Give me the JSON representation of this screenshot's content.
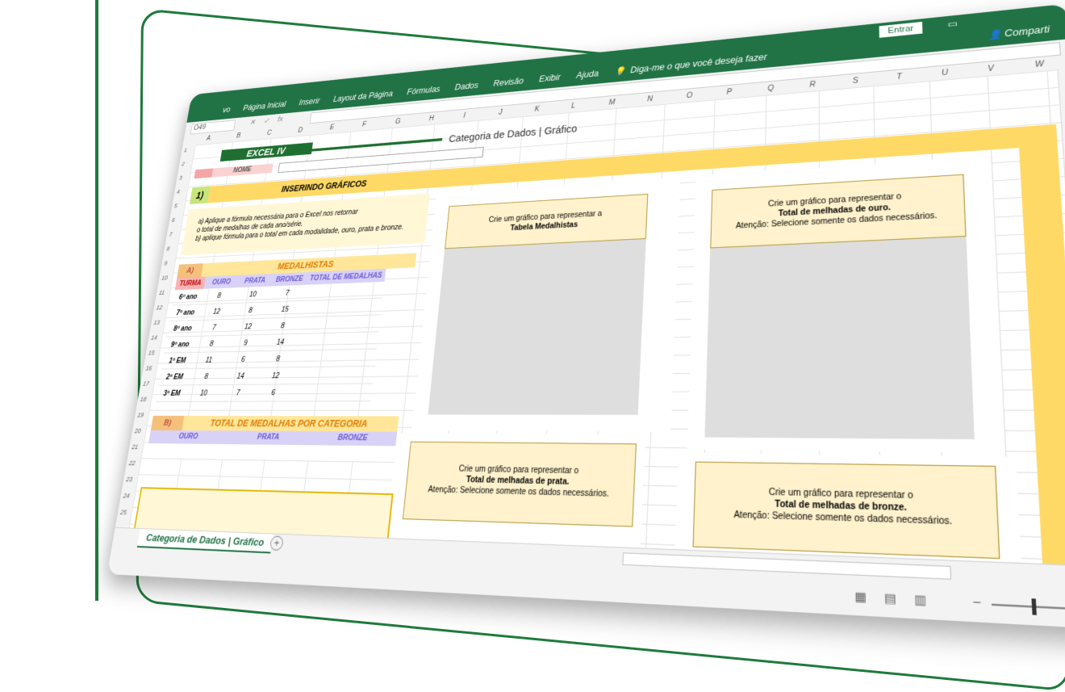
{
  "ribbon": {
    "tabs": [
      "vo",
      "Página Inicial",
      "Inserir",
      "Layout da Página",
      "Fórmulas",
      "Dados",
      "Revisão",
      "Exibir",
      "Ajuda"
    ],
    "tell_me": "Diga-me o que você deseja fazer",
    "entrar": "Entrar",
    "share": "Comparti"
  },
  "formula_bar": {
    "name_box": "O49",
    "cancel": "✕",
    "enter": "✓",
    "fx": "fx"
  },
  "columns": [
    "A",
    "B",
    "C",
    "D",
    "E",
    "F",
    "G",
    "H",
    "I",
    "J",
    "K",
    "L",
    "M",
    "N",
    "O",
    "P",
    "Q",
    "R",
    "S",
    "T",
    "U",
    "V",
    "W"
  ],
  "rows": [
    "1",
    "2",
    "3",
    "4",
    "5",
    "6",
    "7",
    "8",
    "9",
    "10",
    "11",
    "12",
    "13",
    "14",
    "15",
    "16",
    "17",
    "18",
    "19",
    "20",
    "21",
    "22",
    "23",
    "24",
    "25"
  ],
  "sheet": {
    "excel_title": "EXCEL IV",
    "page_title": "Categoria de Dados | Gráfico",
    "nome_label": "NOME",
    "q1_number": "1)",
    "q1_title": "INSERINDO GRÁFICOS",
    "instructions": [
      "a) Aplique a fórmula necessária para o Excel nos retornar",
      "o total de medalhas de cada ano/série.",
      "b) aplique fórmula para o total em cada modalidade, ouro, prata e bronze."
    ]
  },
  "section_a": {
    "label": "A)",
    "title": "MEDALHISTAS",
    "headers": {
      "turma": "TURMA",
      "ouro": "OURO",
      "prata": "PRATA",
      "bronze": "BRONZE",
      "total": "TOTAL DE MEDALHAS"
    },
    "rows": [
      {
        "turma": "6º ano",
        "ouro": "8",
        "prata": "10",
        "bronze": "7",
        "total": ""
      },
      {
        "turma": "7º ano",
        "ouro": "12",
        "prata": "8",
        "bronze": "15",
        "total": ""
      },
      {
        "turma": "8º ano",
        "ouro": "7",
        "prata": "12",
        "bronze": "8",
        "total": ""
      },
      {
        "turma": "9º ano",
        "ouro": "8",
        "prata": "9",
        "bronze": "14",
        "total": ""
      },
      {
        "turma": "1ª EM",
        "ouro": "11",
        "prata": "6",
        "bronze": "8",
        "total": ""
      },
      {
        "turma": "2ª EM",
        "ouro": "8",
        "prata": "14",
        "bronze": "12",
        "total": ""
      },
      {
        "turma": "3ª EM",
        "ouro": "10",
        "prata": "7",
        "bronze": "6",
        "total": ""
      }
    ]
  },
  "section_b": {
    "label": "B)",
    "title": "TOTAL DE MEDALHAS POR CATEGORIA",
    "headers": {
      "ouro": "OURO",
      "prata": "PRATA",
      "bronze": "BRONZE"
    }
  },
  "chart_prompts": {
    "tabela": {
      "line1": "Crie um gráfico para representar a",
      "line2": "Tabela Medalhistas",
      "line3": ""
    },
    "ouro": {
      "line1": "Crie um gráfico para representar o",
      "line2": "Total de melhadas de ouro.",
      "line3": "Atenção: Selecione somente os dados necessários."
    },
    "prata": {
      "line1": "Crie um gráfico para representar o",
      "line2": "Total de melhadas de prata.",
      "line3": "Atenção: Selecione somente os dados necessários."
    },
    "bronze": {
      "line1": "Crie um gráfico para representar o",
      "line2": "Total de melhadas de bronze.",
      "line3": "Atenção: Selecione somente os dados necessários."
    }
  },
  "sheet_tab": {
    "name": "Categoria de Dados | Gráfico",
    "add": "+"
  },
  "colors": {
    "excel_green": "#217346",
    "yellow_band": "#ffd966",
    "prompt_fill": "#fff2cc",
    "lavender": "#d9d2f7",
    "orange_text": "#e07b00"
  }
}
